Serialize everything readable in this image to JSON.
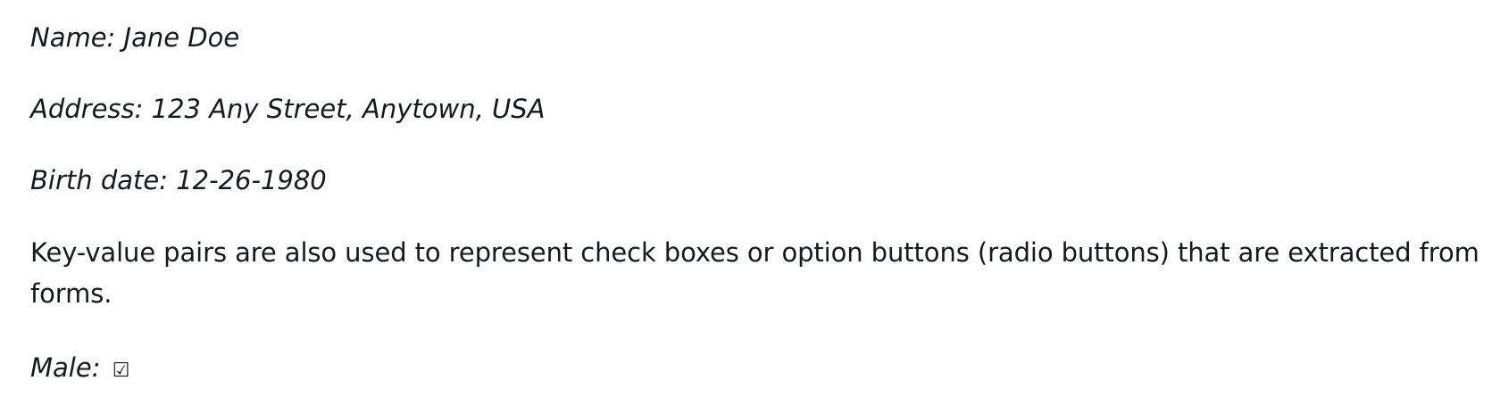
{
  "fields": {
    "name": "Name: Jane Doe",
    "address": "Address: 123 Any Street, Anytown, USA",
    "birth_date": "Birth date: 12-26-1980"
  },
  "paragraph": "Key-value pairs are also used to represent check boxes or option buttons (radio buttons) that are extracted from forms.",
  "checkbox_field": {
    "label": "Male:",
    "mark": "☑"
  }
}
